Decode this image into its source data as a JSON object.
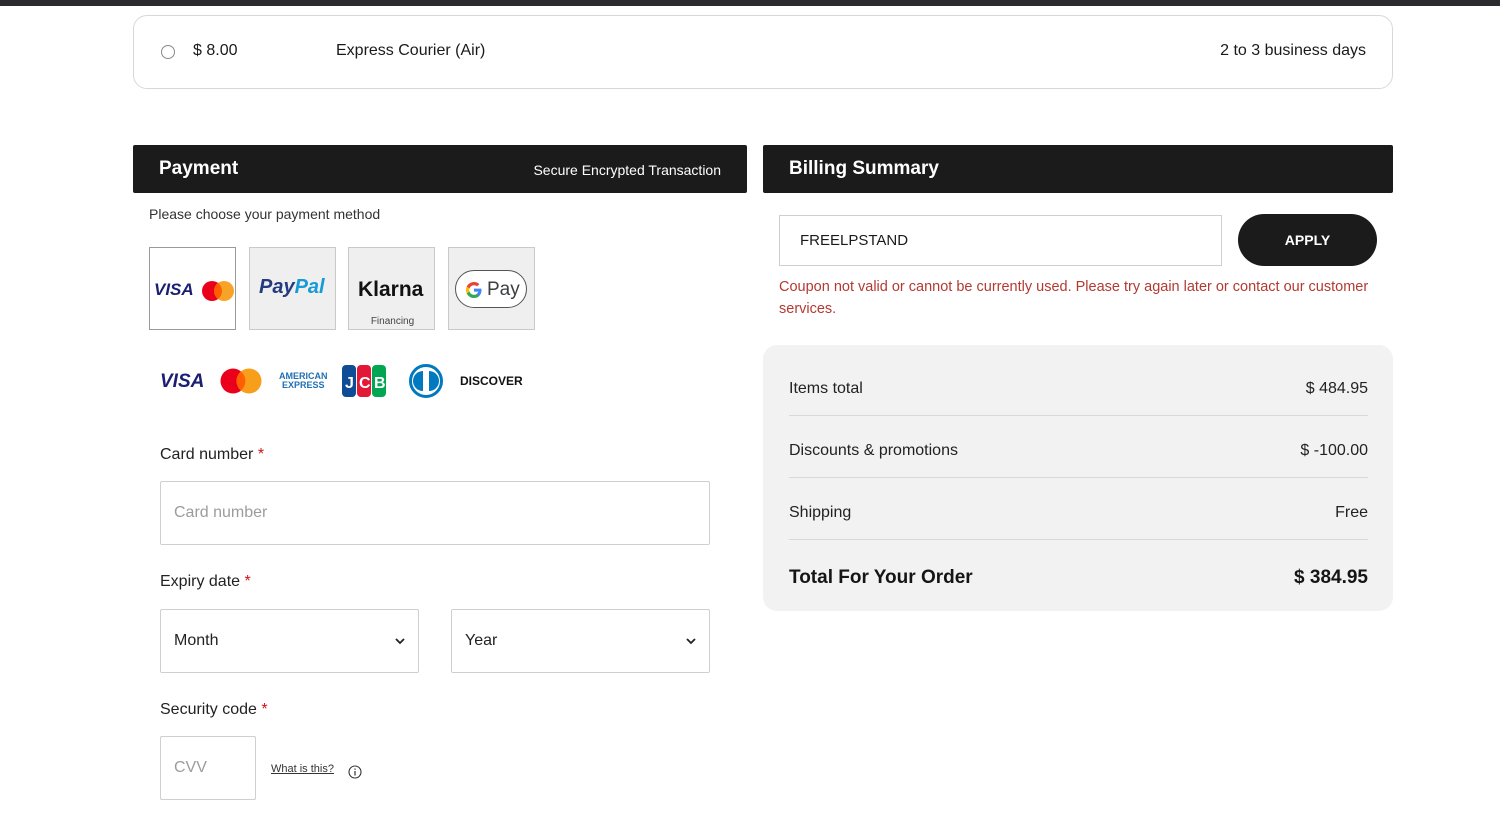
{
  "shipping": {
    "price": "$ 8.00",
    "name": "Express Courier (Air)",
    "delivery": "2 to 3 business days"
  },
  "payment": {
    "title": "Payment",
    "secure_note": "Secure Encrypted Transaction",
    "instruction": "Please choose your payment method",
    "methods": {
      "visa_text": "VISA",
      "paypal_text_a": "Pay",
      "paypal_text_b": "Pal",
      "klarna_text": "Klarna",
      "klarna_sub": "Financing",
      "gpay_text": "Pay"
    },
    "brands": {
      "visa": "VISA",
      "amex_line1": "AMERICAN",
      "amex_line2": "EXPRESS",
      "discover": "DISCOVER"
    },
    "card_number": {
      "label": "Card number",
      "placeholder": "Card number"
    },
    "expiry": {
      "label": "Expiry date",
      "month": "Month",
      "year": "Year"
    },
    "security": {
      "label": "Security code",
      "placeholder": "CVV",
      "help": "What is this?"
    },
    "required_mark": "*"
  },
  "billing": {
    "title": "Billing Summary",
    "coupon_value": "FREELPSTAND",
    "apply_label": "APPLY",
    "coupon_error": "Coupon not valid or cannot be currently used. Please try again later or contact our customer services.",
    "rows": [
      {
        "label": "Items total",
        "value": "$ 484.95"
      },
      {
        "label": "Discounts & promotions",
        "value": "$ -100.00"
      },
      {
        "label": "Shipping",
        "value": "Free"
      }
    ],
    "total": {
      "label": "Total For Your Order",
      "value": "$ 384.95"
    }
  },
  "colors": {
    "header_bg": "#1b1b1b",
    "error": "#b33a32",
    "required": "#d0121b",
    "summary_bg": "#f2f2f2"
  }
}
